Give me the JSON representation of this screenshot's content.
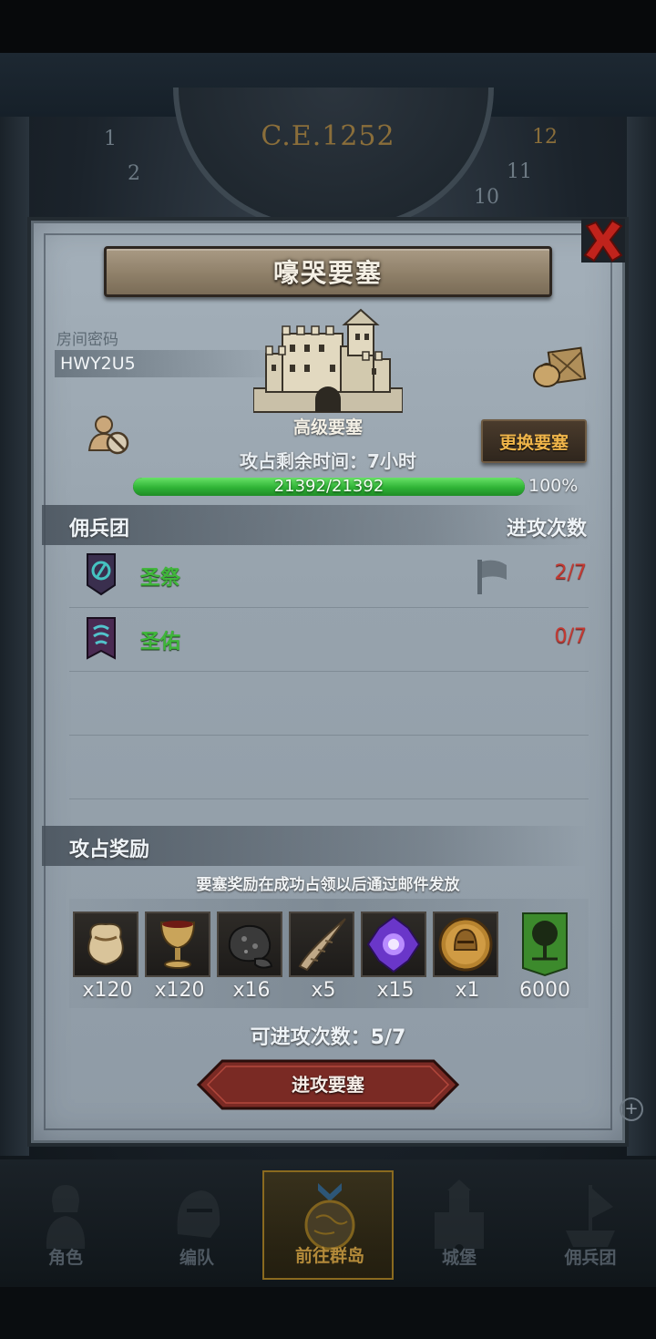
{
  "era": "C.E.1252",
  "dial_numbers": [
    "1",
    "2",
    "12",
    "11",
    "10"
  ],
  "title": "嚎哭要塞",
  "room": {
    "label": "房间密码",
    "code": "HWY2U5"
  },
  "fortress": {
    "level_name": "高级要塞",
    "swap_button": "更换要塞",
    "remaining_time": "攻占剩余时间：7小时",
    "hp_text": "21392/21392",
    "hp_percent_label": "100%",
    "hp_fraction": 1.0
  },
  "mercenary_section": {
    "title": "佣兵团",
    "count_header": "进攻次数"
  },
  "guilds": [
    {
      "name": "圣祭",
      "count": "2/7",
      "banner_color": "#2c9a9a"
    },
    {
      "name": "圣佑",
      "count": "0/7",
      "banner_color": "#3aa3b0"
    }
  ],
  "reward_section": {
    "title": "攻占奖励",
    "note": "要塞奖励在成功占领以后通过邮件发放",
    "items": [
      {
        "icon": "sack-icon",
        "qty": "x120"
      },
      {
        "icon": "goblet-icon",
        "qty": "x120"
      },
      {
        "icon": "ore-icon",
        "qty": "x16"
      },
      {
        "icon": "horn-icon",
        "qty": "x5"
      },
      {
        "icon": "crystal-icon",
        "qty": "x15"
      },
      {
        "icon": "helmet-coin-icon",
        "qty": "x1"
      },
      {
        "icon": "tree-banner-icon",
        "qty": "6000"
      }
    ]
  },
  "attempts": "可进攻次数：5/7",
  "attack_button": "进攻要塞",
  "nav": [
    {
      "label": "角色",
      "icon": "knight-icon"
    },
    {
      "label": "编队",
      "icon": "helmet-icon"
    },
    {
      "label": "前往群岛",
      "icon": "globe-icon",
      "active": true
    },
    {
      "label": "城堡",
      "icon": "castle-icon"
    },
    {
      "label": "佣兵团",
      "icon": "mercenary-ship-icon"
    }
  ],
  "colors": {
    "accent_gold": "#f0b54a",
    "guild_green": "#3fb63a",
    "count_red": "#c33a33",
    "hp_green": "#2fb336"
  }
}
